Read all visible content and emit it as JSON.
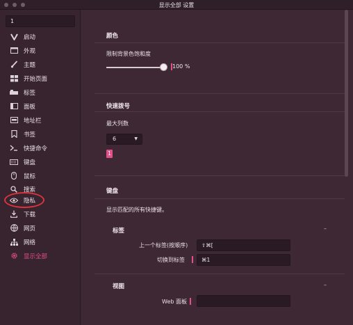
{
  "window": {
    "title": "显示全部 设置"
  },
  "sidebar": {
    "search_value": "1",
    "items": [
      {
        "label": "启动",
        "icon": "v-logo-icon"
      },
      {
        "label": "外观",
        "icon": "window-icon"
      },
      {
        "label": "主题",
        "icon": "brush-icon"
      },
      {
        "label": "开始页面",
        "icon": "grid-icon"
      },
      {
        "label": "标签",
        "icon": "tabs-icon"
      },
      {
        "label": "面板",
        "icon": "panel-icon"
      },
      {
        "label": "地址栏",
        "icon": "addressbar-icon"
      },
      {
        "label": "书签",
        "icon": "bookmark-icon"
      },
      {
        "label": "快捷命令",
        "icon": "command-icon"
      },
      {
        "label": "键盘",
        "icon": "keyboard-icon"
      },
      {
        "label": "鼠标",
        "icon": "mouse-icon"
      },
      {
        "label": "搜索",
        "icon": "search-icon"
      },
      {
        "label": "隐私",
        "icon": "eye-icon"
      },
      {
        "label": "下载",
        "icon": "download-icon"
      },
      {
        "label": "网页",
        "icon": "globe-icon"
      },
      {
        "label": "网络",
        "icon": "network-icon"
      },
      {
        "label": "显示全部",
        "icon": "gear-icon"
      }
    ],
    "active_label": "显示全部"
  },
  "color": {
    "title": "颜色",
    "saturation_label": "限制背景色饱和度",
    "saturation_value": "100 %",
    "saturation_fraction": 1.0
  },
  "speeddial": {
    "title": "快速拨号",
    "max_columns_label": "最大列数",
    "max_columns_value": "6",
    "match_badge": "1"
  },
  "keyboard": {
    "title": "键盘",
    "description": "显示匹配的所有快捷键。",
    "group_tabs": {
      "title": "标签",
      "collapse": "–",
      "rows": [
        {
          "label": "上一个标签(按顺序)",
          "value": "⇧⌘["
        },
        {
          "label": "切换到标签",
          "value": "⌘1"
        }
      ]
    },
    "group_view": {
      "title": "视图",
      "collapse": "–",
      "rows": [
        {
          "label": "Web 面板",
          "value": ""
        }
      ]
    }
  },
  "colors": {
    "accent": "#e34f8a",
    "background": "#3d2834",
    "sidebar": "#38242f",
    "highlight_ring": "#d9343f"
  }
}
